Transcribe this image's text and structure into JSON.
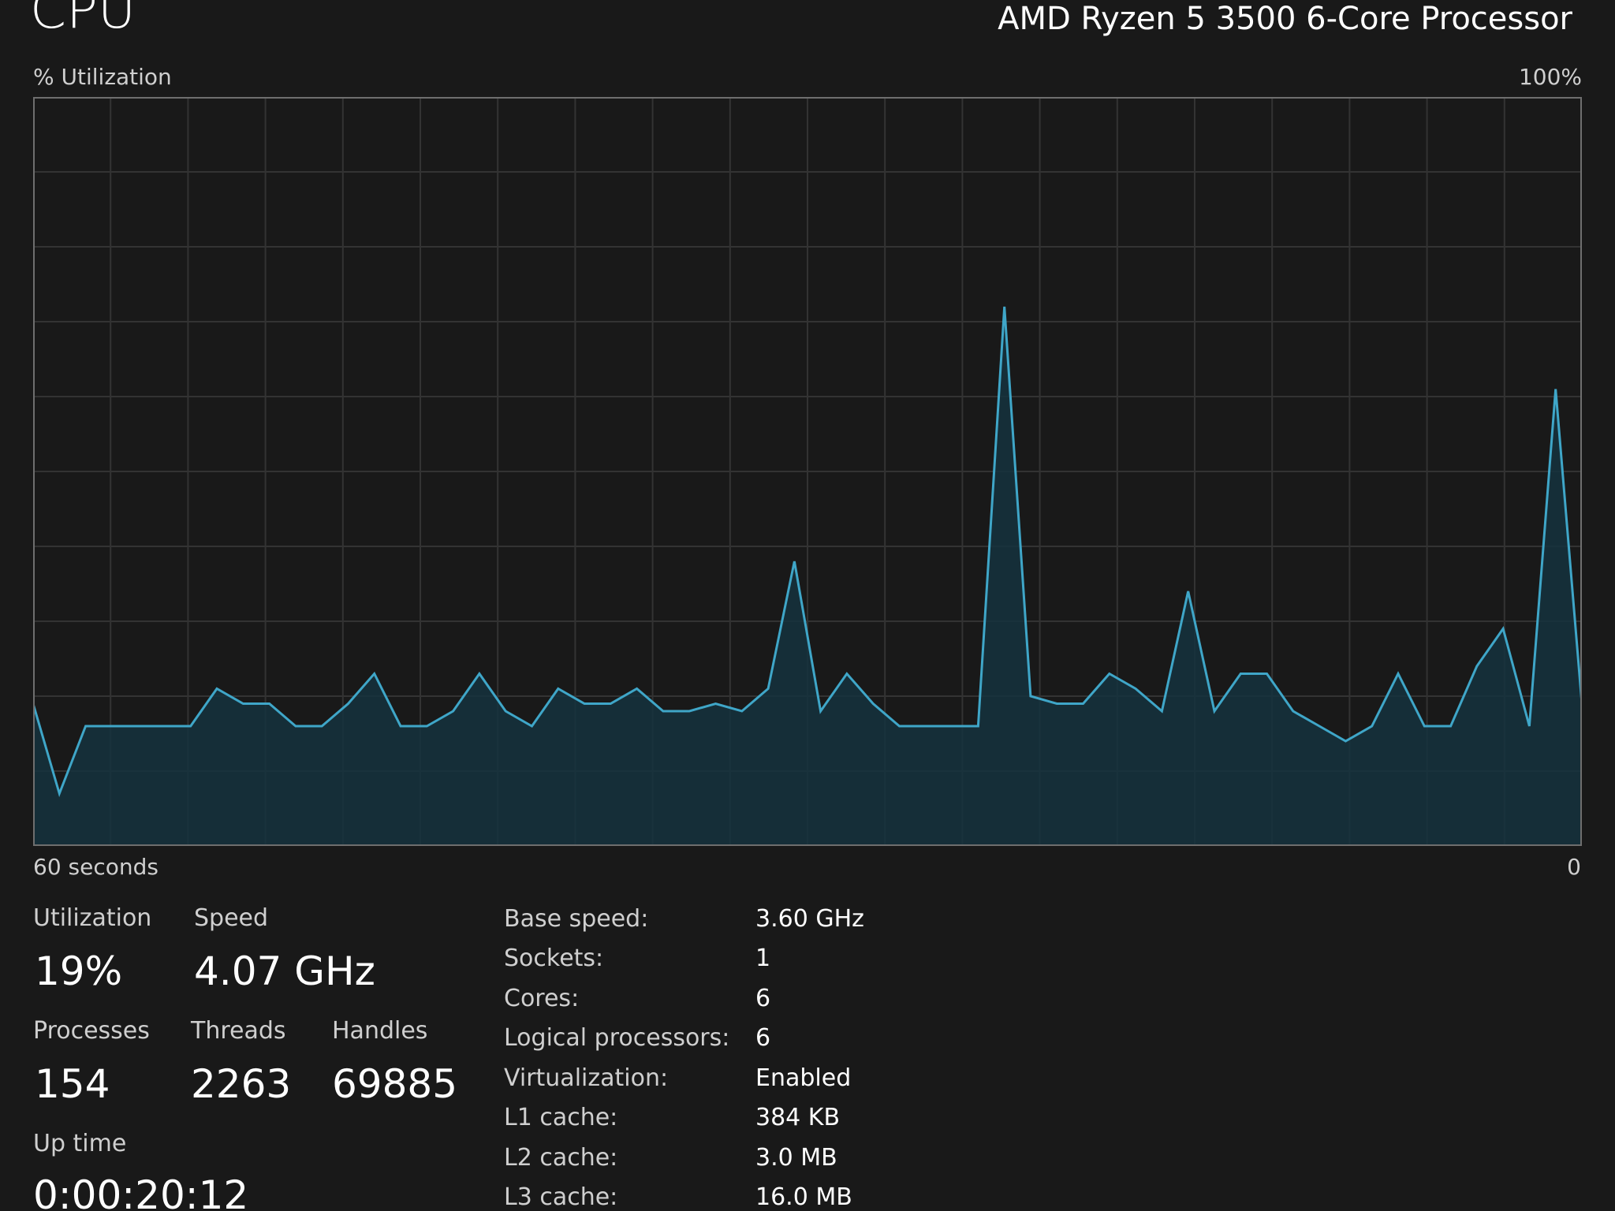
{
  "header": {
    "title": "CPU",
    "processor": "AMD Ryzen 5 3500 6-Core Processor"
  },
  "graph": {
    "y_label": "% Utilization",
    "y_max_label": "100%",
    "x_label": "60 seconds",
    "x_end_label": "0",
    "line_color": "#3fa6c8",
    "fill_color": "#15323e",
    "grid_color": "#333333",
    "border_color": "#6e6e6e"
  },
  "chart_data": {
    "type": "area",
    "xlim": [
      60,
      0
    ],
    "ylim": [
      0,
      100
    ],
    "grid": true,
    "values": [
      19,
      7,
      16,
      16,
      16,
      16,
      16,
      21,
      19,
      19,
      16,
      16,
      19,
      23,
      16,
      16,
      18,
      23,
      18,
      16,
      21,
      19,
      19,
      21,
      18,
      18,
      19,
      18,
      21,
      38,
      18,
      23,
      19,
      16,
      16,
      16,
      16,
      72,
      20,
      19,
      19,
      23,
      21,
      18,
      34,
      18,
      23,
      23,
      18,
      16,
      14,
      16,
      23,
      16,
      16,
      24,
      29,
      16,
      61,
      19
    ]
  },
  "stats": {
    "utilization_label": "Utilization",
    "utilization_value": "19%",
    "speed_label": "Speed",
    "speed_value": "4.07 GHz",
    "processes_label": "Processes",
    "processes_value": "154",
    "threads_label": "Threads",
    "threads_value": "2263",
    "handles_label": "Handles",
    "handles_value": "69885",
    "uptime_label": "Up time",
    "uptime_value": "0:00:20:12"
  },
  "info": [
    {
      "label": "Base speed:",
      "value": "3.60 GHz"
    },
    {
      "label": "Sockets:",
      "value": "1"
    },
    {
      "label": "Cores:",
      "value": "6"
    },
    {
      "label": "Logical processors:",
      "value": "6"
    },
    {
      "label": "Virtualization:",
      "value": "Enabled"
    },
    {
      "label": "L1 cache:",
      "value": "384 KB"
    },
    {
      "label": "L2 cache:",
      "value": "3.0 MB"
    },
    {
      "label": "L3 cache:",
      "value": "16.0 MB"
    }
  ]
}
